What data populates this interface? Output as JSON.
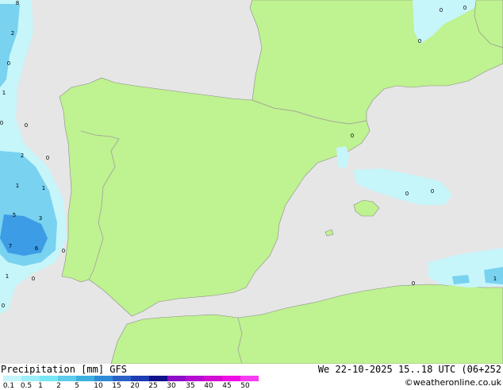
{
  "footer": {
    "title": "Precipitation [mm] GFS",
    "datetime": "We 22-10-2025 15..18 UTC (06+252",
    "site": "©weatheronline.co.uk"
  },
  "scale": {
    "labels": [
      "0.1",
      "0.5",
      "1",
      "2",
      "5",
      "10",
      "15",
      "20",
      "25",
      "30",
      "35",
      "40",
      "45",
      "50"
    ],
    "colors": [
      "#c6f5fa",
      "#9ceef7",
      "#78e6f3",
      "#5dcbeb",
      "#3eb0e0",
      "#2e8bd8",
      "#2a62c8",
      "#1e3cb4",
      "#12118c",
      "#8c0cc8",
      "#b40cd2",
      "#d20cd2",
      "#f00ce6",
      "#f83cf0"
    ]
  },
  "map": {
    "colors": {
      "sea": "#e6e6e6",
      "land": "#bff290",
      "border": "#a0a0a0",
      "light_precip": "#c6f5fa",
      "medium_precip": "#78d2f0",
      "heavy_precip": "#3c9ce6"
    },
    "value_labels": [
      "8",
      "2",
      "0",
      "1",
      "0",
      "0",
      "2",
      "0",
      "1",
      "1",
      "5",
      "3",
      "7",
      "6",
      "0",
      "1",
      "0",
      "0",
      "0",
      "0",
      "0",
      "0",
      "0",
      "0",
      "0",
      "1"
    ]
  }
}
